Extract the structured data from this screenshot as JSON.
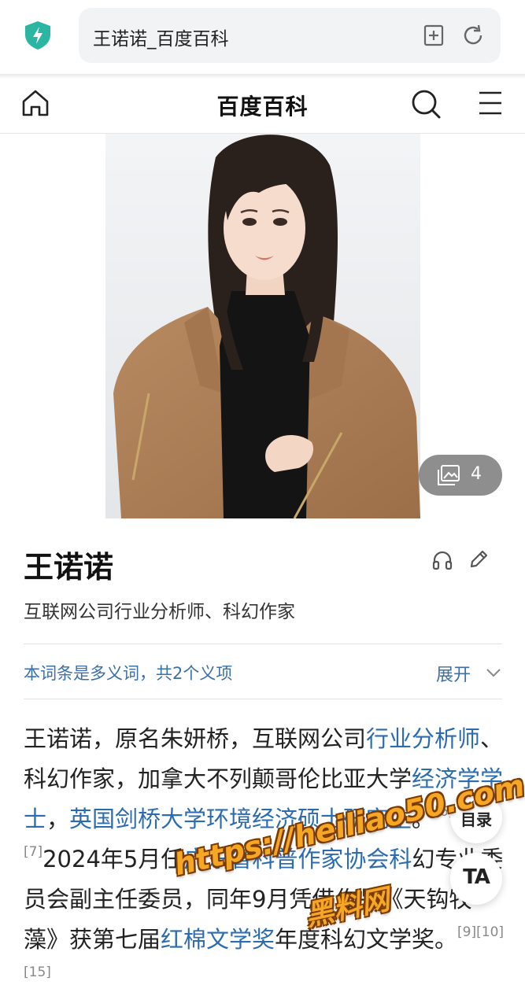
{
  "browser": {
    "url_title": "王诺诺_百度百科"
  },
  "header": {
    "site_title": "百度百科"
  },
  "media": {
    "photo_count": "4"
  },
  "lemma": {
    "title": "王诺诺",
    "description": "互联网公司行业分析师、科幻作家",
    "polysemy_note": "本词条是多义词，共2个义项",
    "expand_label": "展开"
  },
  "summary": {
    "t1": "王诺诺，原名朱妍桥，互联网公司",
    "l1": "行业分析师",
    "t2": "、科幻作家，加拿大不列颠哥伦比亚大学",
    "l2": "经济学学士",
    "t3": "，",
    "l3": "英国剑桥大学环境经济硕士研究生",
    "t4": "。",
    "ref1": "[6][7]",
    "t5": "2024年5月任",
    "l4": "广东省科普作家协会科",
    "t6": "幻专业委员会副主任委员，同年9月凭借作品《天钩牧藻》获第七届",
    "l5": "红棉文学奖",
    "t7": "年度科幻文学奖。",
    "ref2": "[9][10][15]"
  },
  "floating": {
    "toc_label": "目录",
    "font_label": "TA"
  },
  "watermark": {
    "url": "https://heiliao50.com",
    "name": "黑料网"
  },
  "colors": {
    "link": "#2b6cb0",
    "secondary_link": "#3a6fa8",
    "shield": "#2bb5a3",
    "watermark": "#f5a623"
  }
}
